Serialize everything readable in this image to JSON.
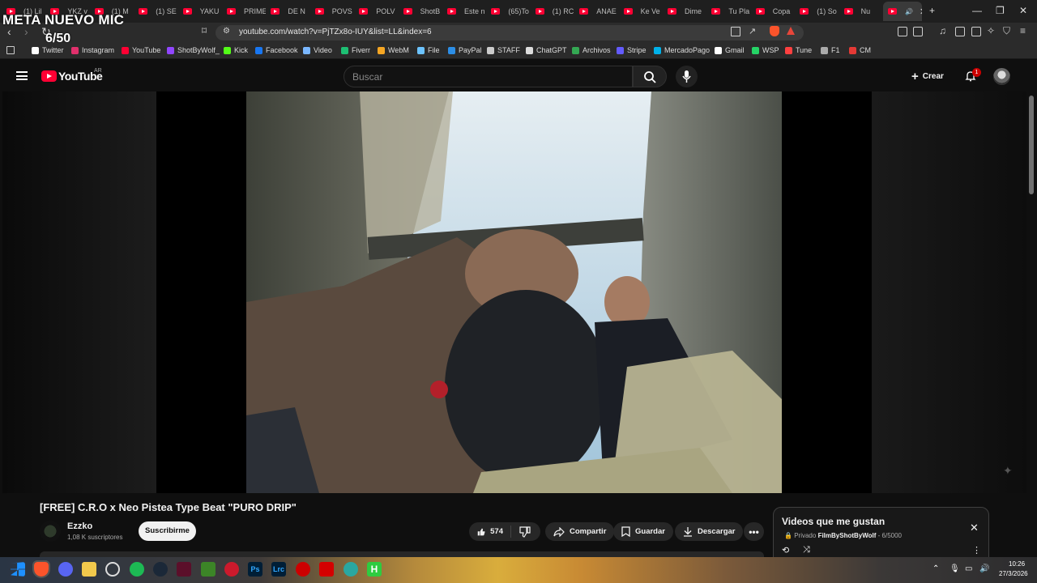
{
  "overlay": {
    "title": "META NUEVO MIC",
    "counter": "6/50"
  },
  "tabs": [
    "(1) Lil",
    "YKZ v",
    "(1) M",
    "(1) SE",
    "YAKU",
    "PRIME",
    "DE N",
    "POVS",
    "POLV",
    "ShotB",
    "Este n",
    "(65)To",
    "(1) RC",
    "ANAE",
    "Ke Ve",
    "Dime",
    "Tu Pla",
    "Copa",
    "(1) So",
    "Nu",
    ""
  ],
  "active_tab_index": 20,
  "address": {
    "url": "youtube.com/watch?v=PjTZx8o-IUY&list=LL&index=6"
  },
  "bookmarks": [
    {
      "label": "Twitter",
      "color": "#ffffff"
    },
    {
      "label": "Instagram",
      "color": "#e1306c"
    },
    {
      "label": "YouTube",
      "color": "#ff0033"
    },
    {
      "label": "ShotByWolf_",
      "color": "#9146ff"
    },
    {
      "label": "Kick",
      "color": "#53fc18"
    },
    {
      "label": "Facebook",
      "color": "#1877f2"
    },
    {
      "label": "Video",
      "color": "#7ab7ff"
    },
    {
      "label": "Fiverr",
      "color": "#1dbf73"
    },
    {
      "label": "WebM",
      "color": "#f5a623"
    },
    {
      "label": "File",
      "color": "#6cc3ff"
    },
    {
      "label": "PayPal",
      "color": "#2c8ee6"
    },
    {
      "label": "STAFF",
      "color": "#cccccc"
    },
    {
      "label": "ChatGPT",
      "color": "#dddddd"
    },
    {
      "label": "Archivos",
      "color": "#34a853"
    },
    {
      "label": "Stripe",
      "color": "#635bff"
    },
    {
      "label": "MercadoPago",
      "color": "#00b1ea"
    },
    {
      "label": "Gmail",
      "color": "#ffffff"
    },
    {
      "label": "WSP",
      "color": "#25d366"
    },
    {
      "label": "Tune",
      "color": "#ff4040"
    },
    {
      "label": "F1",
      "color": "#aaaaaa"
    },
    {
      "label": "CM",
      "color": "#e53935"
    }
  ],
  "youtube": {
    "logo_text": "YouTube",
    "country": "AR",
    "search_placeholder": "Buscar",
    "create_label": "Crear",
    "notifications": "1"
  },
  "video": {
    "title": "[FREE] C.R.O x Neo Pistea Type Beat \"PURO DRIP\"",
    "channel": "Ezzko",
    "subscribers": "1,08 K suscriptores",
    "subscribe_label": "Suscribirme",
    "likes": "574",
    "share_label": "Compartir",
    "save_label": "Guardar",
    "download_label": "Descargar"
  },
  "playlist": {
    "title": "Videos que me gustan",
    "privacy": "Privado",
    "owner": "FilmByShotByWolf",
    "position": "6/5000"
  },
  "clock": {
    "time": "10:26",
    "date": "27/3/2026"
  },
  "colors": {
    "youtube_red": "#ff0033",
    "bg": "#0f0f0f",
    "pill": "#272727"
  }
}
